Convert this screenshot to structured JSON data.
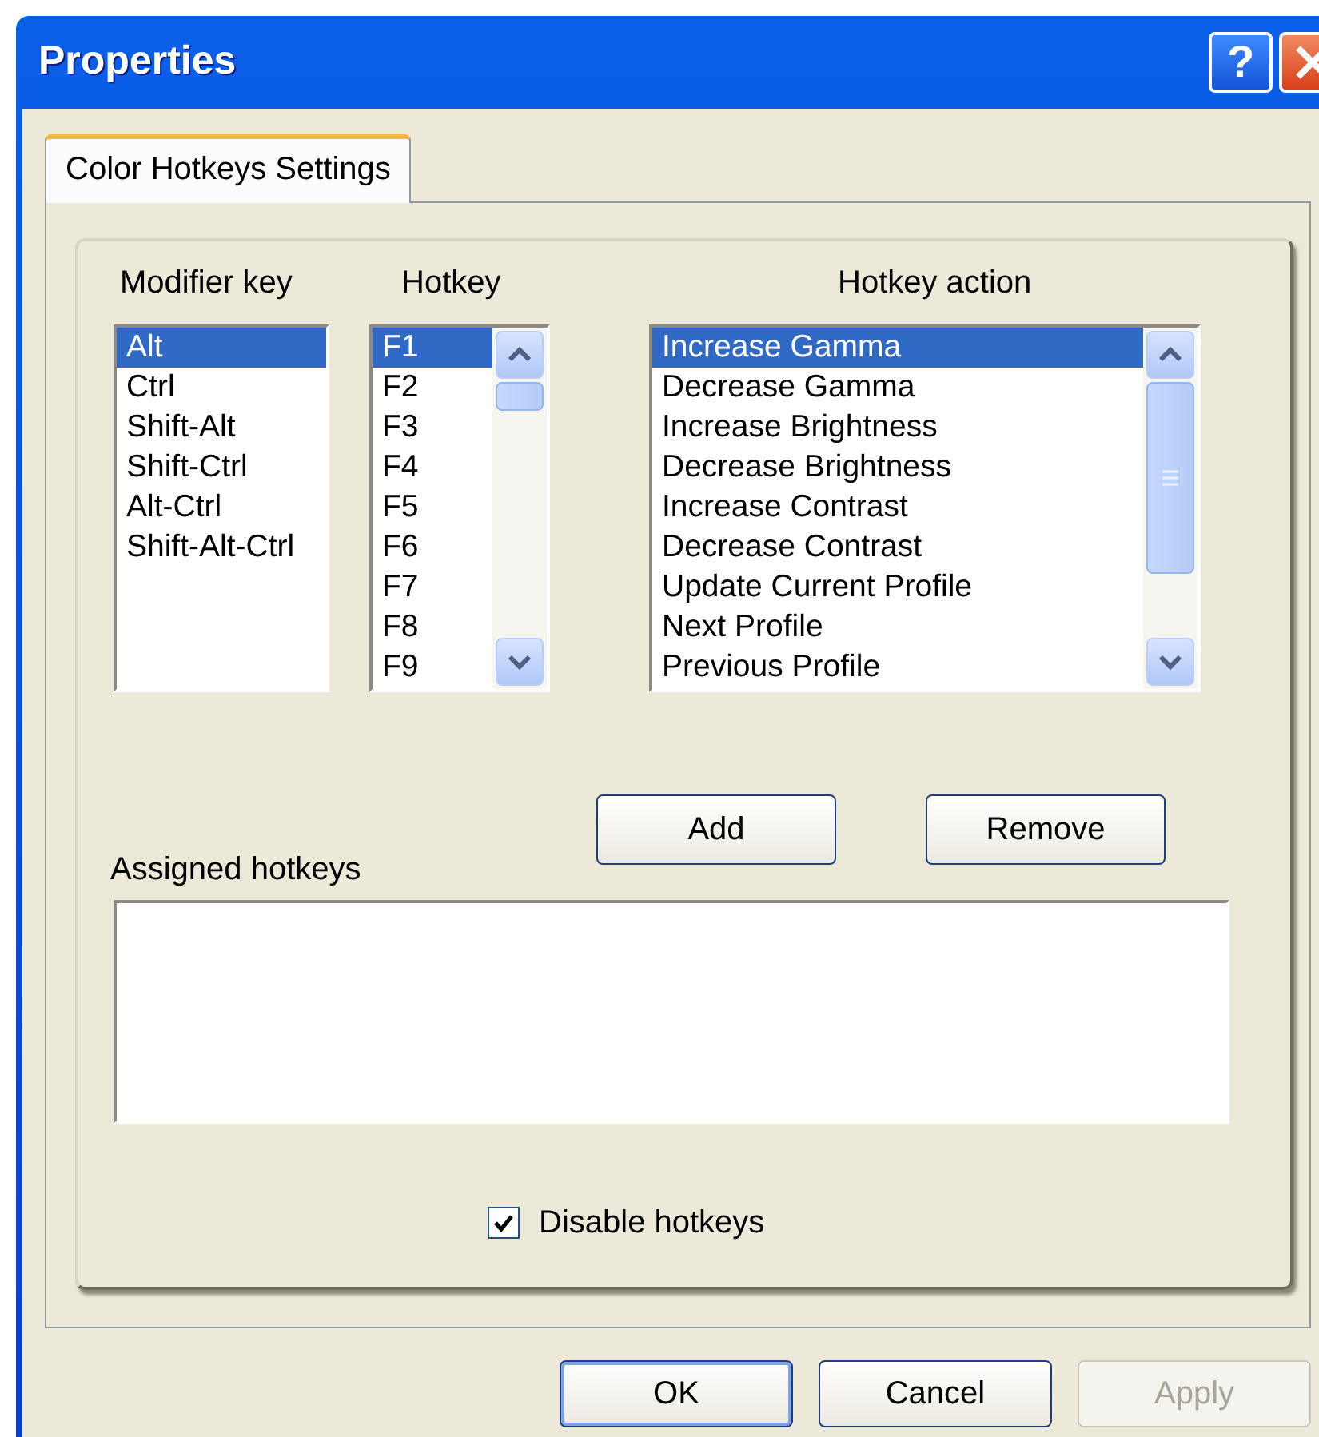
{
  "window": {
    "title": "Properties",
    "help_button": "?"
  },
  "tabs": [
    {
      "label": "Color Hotkeys Settings",
      "selected": true
    }
  ],
  "lists": [
    {
      "label": "Modifier key",
      "scrollbar": false,
      "items": [
        {
          "text": "Alt",
          "selected": true
        },
        {
          "text": "Ctrl",
          "selected": false
        },
        {
          "text": "Shift-Alt",
          "selected": false
        },
        {
          "text": "Shift-Ctrl",
          "selected": false
        },
        {
          "text": "Alt-Ctrl",
          "selected": false
        },
        {
          "text": "Shift-Alt-Ctrl",
          "selected": false
        }
      ]
    },
    {
      "label": "Hotkey",
      "scrollbar": true,
      "items": [
        {
          "text": "F1",
          "selected": true
        },
        {
          "text": "F2",
          "selected": false
        },
        {
          "text": "F3",
          "selected": false
        },
        {
          "text": "F4",
          "selected": false
        },
        {
          "text": "F5",
          "selected": false
        },
        {
          "text": "F6",
          "selected": false
        },
        {
          "text": "F7",
          "selected": false
        },
        {
          "text": "F8",
          "selected": false
        },
        {
          "text": "F9",
          "selected": false
        }
      ]
    },
    {
      "label": "Hotkey action",
      "scrollbar": true,
      "items": [
        {
          "text": "Increase Gamma",
          "selected": true
        },
        {
          "text": "Decrease Gamma",
          "selected": false
        },
        {
          "text": "Increase Brightness",
          "selected": false
        },
        {
          "text": "Decrease Brightness",
          "selected": false
        },
        {
          "text": "Increase Contrast",
          "selected": false
        },
        {
          "text": "Decrease Contrast",
          "selected": false
        },
        {
          "text": "Update Current Profile",
          "selected": false
        },
        {
          "text": "Next Profile",
          "selected": false
        },
        {
          "text": "Previous Profile",
          "selected": false
        }
      ]
    }
  ],
  "action_buttons": [
    "Add",
    "Remove"
  ],
  "assigned": {
    "label": "Assigned hotkeys"
  },
  "disable_hotkeys": {
    "label": "Disable hotkeys",
    "checked": true
  },
  "dialog_buttons": [
    {
      "label": "OK",
      "default": true,
      "disabled": false
    },
    {
      "label": "Cancel",
      "default": false,
      "disabled": false
    },
    {
      "label": "Apply",
      "default": false,
      "disabled": true
    }
  ]
}
